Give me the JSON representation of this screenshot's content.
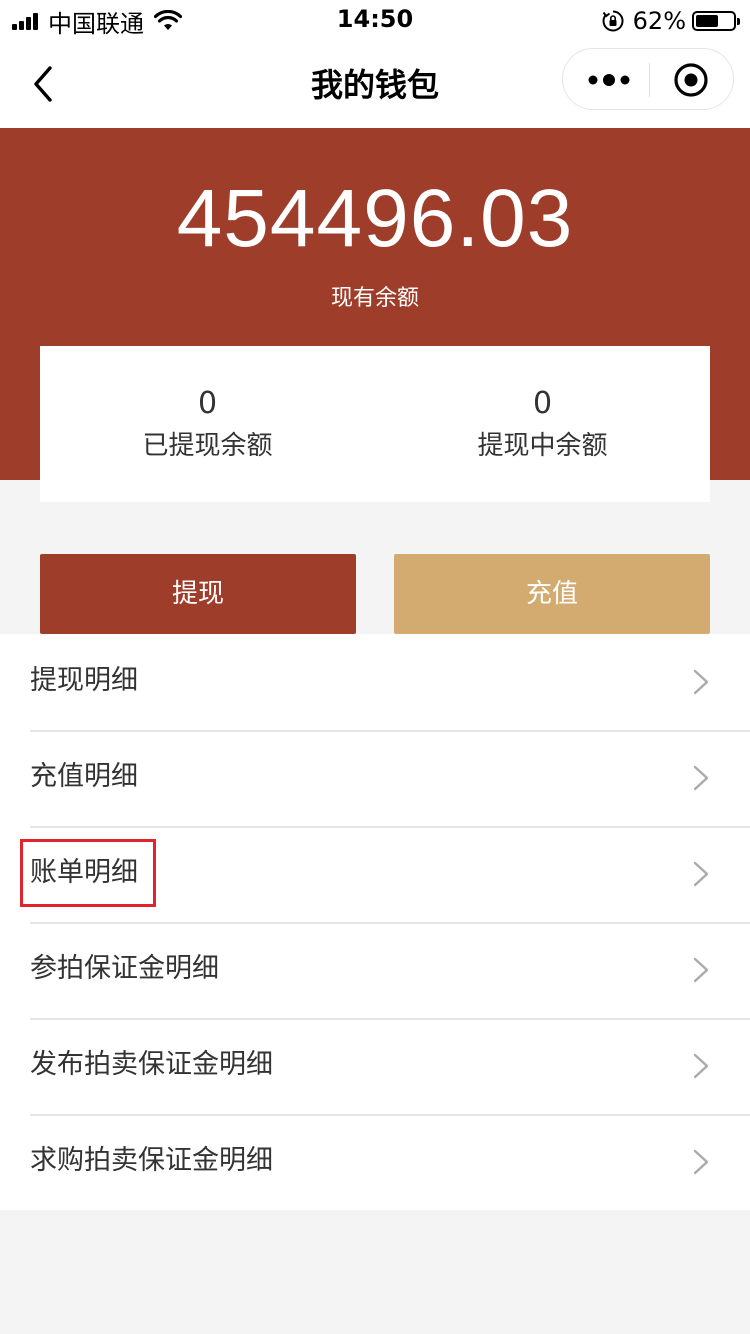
{
  "status_bar": {
    "carrier": "中国联通",
    "time": "14:50",
    "battery_percent": "62%",
    "battery_level": 0.62,
    "icons": [
      "signal-icon",
      "wifi-icon",
      "orientation-lock-icon",
      "battery-icon"
    ]
  },
  "nav": {
    "title": "我的钱包",
    "icons": [
      "back-arrow-icon",
      "more-dots-icon",
      "close-target-icon"
    ]
  },
  "wallet": {
    "balance": "454496.03",
    "balance_label": "现有余额",
    "withdrawn_value": "0",
    "withdrawn_label": "已提现余额",
    "pending_value": "0",
    "pending_label": "提现中余额"
  },
  "actions": {
    "withdraw_label": "提现",
    "recharge_label": "充值"
  },
  "detail_items": [
    {
      "label": "提现明细"
    },
    {
      "label": "充值明细"
    },
    {
      "label": "账单明细"
    },
    {
      "label": "参拍保证金明细"
    },
    {
      "label": "发布拍卖保证金明细"
    },
    {
      "label": "求购拍卖保证金明细"
    }
  ],
  "colors": {
    "brand_red": "#9f3d2b",
    "gold": "#d3aa70",
    "highlight": "#e0242e",
    "background": "#f4f4f4"
  }
}
